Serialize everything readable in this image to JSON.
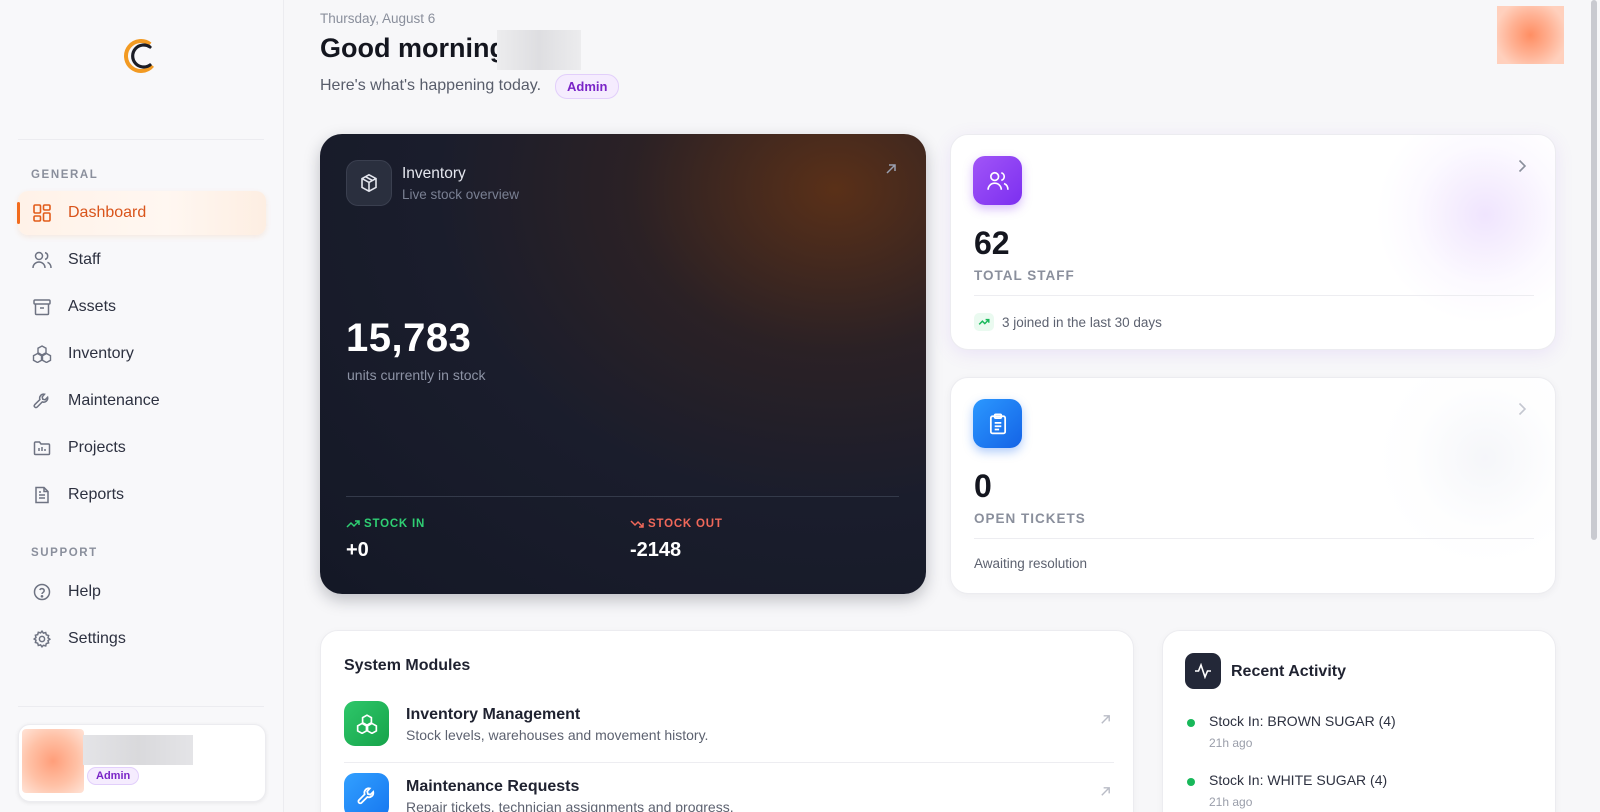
{
  "header": {
    "date": "Thursday, August 6",
    "greeting": "Good morning",
    "subline": "Here's what's happening today.",
    "role_badge": "Admin"
  },
  "sidebar": {
    "sections": [
      {
        "label": "GENERAL"
      },
      {
        "label": "SUPPORT"
      }
    ],
    "items": [
      {
        "label": "Dashboard",
        "icon": "dashboard-icon",
        "active": true
      },
      {
        "label": "Staff",
        "icon": "users-icon"
      },
      {
        "label": "Assets",
        "icon": "archive-icon"
      },
      {
        "label": "Inventory",
        "icon": "boxes-icon"
      },
      {
        "label": "Maintenance",
        "icon": "wrench-icon"
      },
      {
        "label": "Projects",
        "icon": "projects-icon"
      },
      {
        "label": "Reports",
        "icon": "document-icon"
      },
      {
        "label": "Help",
        "icon": "help-icon"
      },
      {
        "label": "Settings",
        "icon": "gear-icon"
      }
    ],
    "user": {
      "role_badge": "Admin"
    }
  },
  "inventory_card": {
    "title": "Inventory",
    "subtitle": "Live stock overview",
    "value": "15,783",
    "units_label": "units currently in stock",
    "stock_in_label": "STOCK IN",
    "stock_in_value": "+0",
    "stock_out_label": "STOCK OUT",
    "stock_out_value": "-2148"
  },
  "stats": [
    {
      "value": "62",
      "label": "TOTAL STAFF",
      "footer": "3 joined in the last 30 days",
      "icon": "users-icon",
      "accent": "#8b3ff0"
    },
    {
      "value": "0",
      "label": "OPEN TICKETS",
      "footer": "Awaiting resolution",
      "icon": "clipboard-icon",
      "accent": "#1d7cf2"
    }
  ],
  "modules": {
    "title": "System Modules",
    "items": [
      {
        "name": "Inventory Management",
        "description": "Stock levels, warehouses and movement history.",
        "icon": "boxes-icon",
        "color": "#1fb45a"
      },
      {
        "name": "Maintenance Requests",
        "description": "Repair tickets, technician assignments and progress.",
        "icon": "wrench-icon",
        "color": "#1d86f5"
      }
    ]
  },
  "activity": {
    "title": "Recent Activity",
    "items": [
      {
        "text": "Stock In: BROWN SUGAR (4)",
        "time": "21h ago"
      },
      {
        "text": "Stock In: WHITE SUGAR (4)",
        "time": "21h ago"
      }
    ]
  },
  "colors": {
    "accent_orange": "#f26b1d",
    "badge_purple": "#7a24c7",
    "positive_green": "#18b85a",
    "negative_red": "#f0685a"
  }
}
